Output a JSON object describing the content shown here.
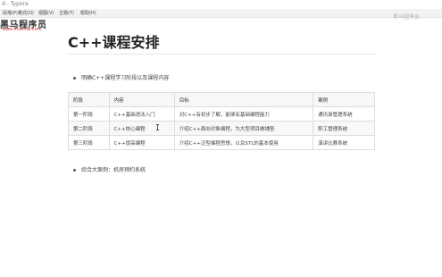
{
  "window": {
    "title": "d - Typora"
  },
  "menu": [
    {
      "label": "段落(P)"
    },
    {
      "label": "格式(O)"
    },
    {
      "label": "视图(V)"
    },
    {
      "label": "主题(T)"
    },
    {
      "label": "帮助(H)"
    }
  ],
  "logo": {
    "name": "黑马程序员",
    "url": "www.itheima.com"
  },
  "watermark": "黑马程序员",
  "doc": {
    "title": "C++课程安排",
    "intro": "明确C++课程学习阶段以及课程内容",
    "table": {
      "headers": [
        "阶段",
        "内容",
        "目标",
        "案例"
      ],
      "rows": [
        [
          "第一阶段",
          "C++基础语法入门",
          "对C++有初步了解，能够有基础编程能力",
          "通讯录管理系统"
        ],
        [
          "第二阶段",
          "C++核心编程",
          "介绍C++面向对象编程，为大型项目做铺垫",
          "职工管理系统"
        ],
        [
          "第三阶段",
          "C++提高编程",
          "介绍C++泛型编程思想，以及STL的基本使用",
          "演讲比赛系统"
        ]
      ]
    },
    "summary": "综合大案例：机房预约系统"
  }
}
